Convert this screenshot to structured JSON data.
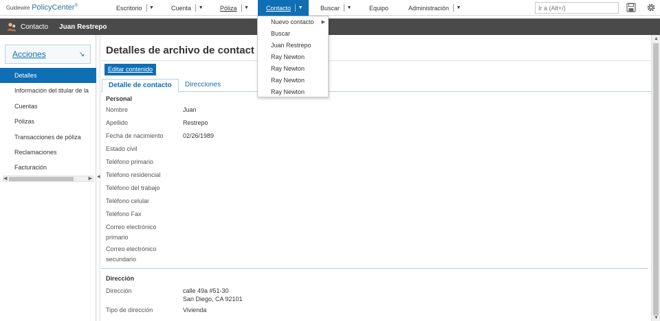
{
  "app": {
    "brand_small": "Guidewire",
    "brand": "PolicyCenter",
    "brand_mark": "®"
  },
  "nav": {
    "items": [
      {
        "label": "Escritorio"
      },
      {
        "label": "Cuenta"
      },
      {
        "label": "Póliza"
      },
      {
        "label": "Contacto"
      },
      {
        "label": "Buscar"
      },
      {
        "label": "Equipo"
      },
      {
        "label": "Administración"
      }
    ],
    "search_placeholder": "Ir a (Alt+/)"
  },
  "subbar": {
    "context": "Contacto",
    "name": "Juan Restrepo"
  },
  "sidebar": {
    "actions_label": "Acciones",
    "items": [
      {
        "label": "Detalles"
      },
      {
        "label": "Información del titular de la"
      },
      {
        "label": "Cuentas"
      },
      {
        "label": "Pólizas"
      },
      {
        "label": "Transacciones de póliza"
      },
      {
        "label": "Reclamaciones"
      },
      {
        "label": "Facturación"
      }
    ]
  },
  "main": {
    "title": "Detalles de archivo de contact",
    "edit_button": "Editar contenido",
    "tabs": [
      {
        "label": "Detalle de contacto"
      },
      {
        "label": "Direcciones"
      }
    ],
    "personal": {
      "title": "Personal",
      "fields": [
        {
          "label": "Nombre",
          "value": "Juan"
        },
        {
          "label": "Apellido",
          "value": "Restrepo"
        },
        {
          "label": "Fecha de nacimiento",
          "value": "02/26/1989"
        },
        {
          "label": "Estado civil",
          "value": ""
        },
        {
          "label": "Teléfono primario",
          "value": ""
        },
        {
          "label": "Teléfono residencial",
          "value": ""
        },
        {
          "label": "Teléfono del trabajo",
          "value": ""
        },
        {
          "label": "Teléfono celular",
          "value": ""
        },
        {
          "label": "Teléfono Fax",
          "value": ""
        },
        {
          "label": "Correo electrónico primario",
          "value": ""
        },
        {
          "label": "Correo electrónico secundario",
          "value": ""
        }
      ]
    },
    "address": {
      "title": "Dirección",
      "fields": [
        {
          "label": "Dirección",
          "value_line1": "calle 49a #51-30",
          "value_line2": "San Diego, CA 92101"
        },
        {
          "label": "Tipo de dirección",
          "value": "Vivienda"
        }
      ]
    }
  },
  "dropdown": {
    "items": [
      {
        "label": "Nuevo contacto"
      },
      {
        "label": "Buscar"
      },
      {
        "label": "Juan Restrepo"
      },
      {
        "label": "Ray Newton"
      },
      {
        "label": "Ray Newton"
      },
      {
        "label": "Ray Newton"
      },
      {
        "label": "Ray Newton"
      }
    ]
  },
  "colors": {
    "accent": "#0f6eb4",
    "subbar": "#4a4a4a"
  },
  "icons": [
    "contact-icon",
    "save-icon",
    "settings-gear-icon",
    "caret-down-icon",
    "chevron-right-icon",
    "diagonal-arrow-icon"
  ]
}
